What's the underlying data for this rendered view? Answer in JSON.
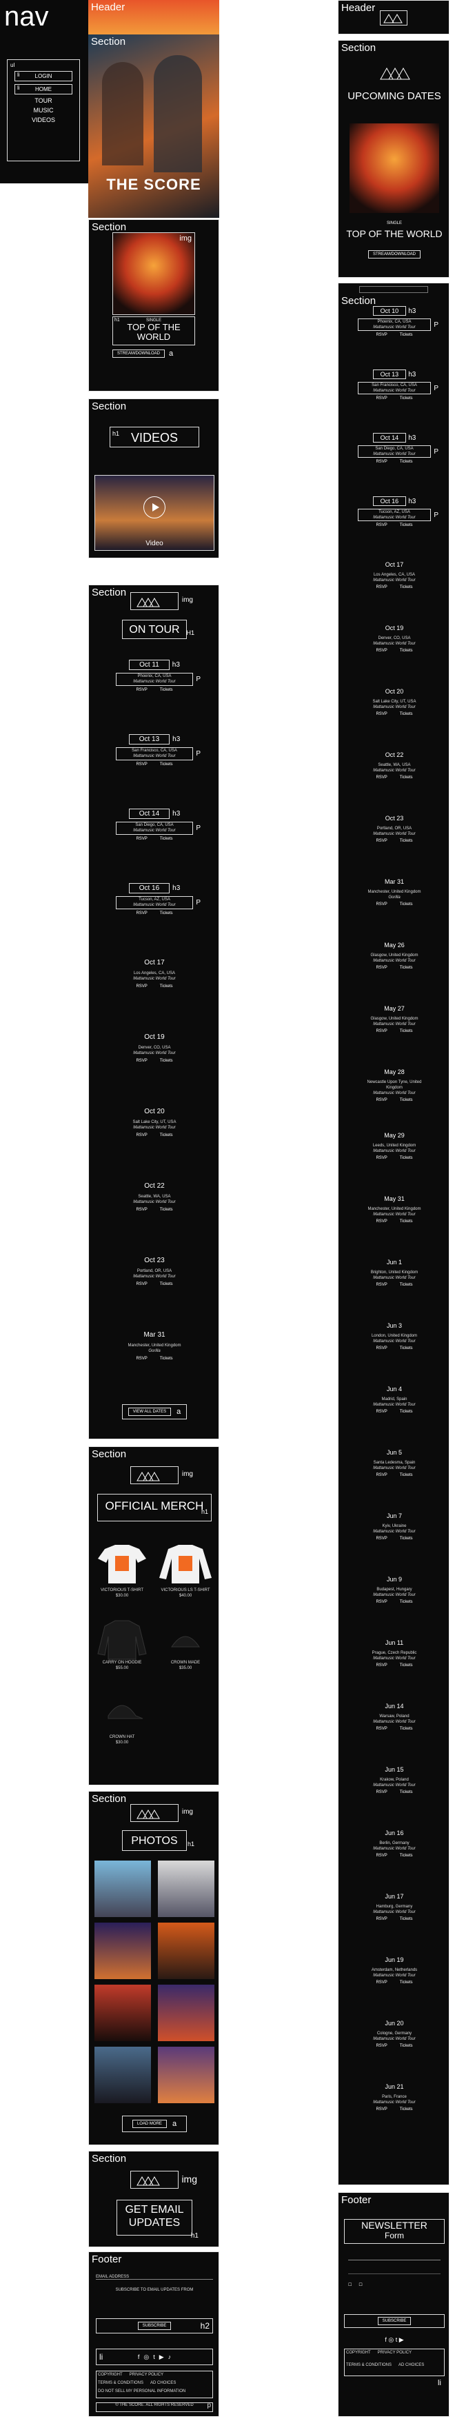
{
  "nav": {
    "title": "nav",
    "items": [
      {
        "tag": "li",
        "label": "LOGIN",
        "mark": "li"
      },
      {
        "tag": "li",
        "label": "HOME",
        "mark": "li"
      },
      {
        "label": "TOUR"
      },
      {
        "label": "MUSIC"
      },
      {
        "label": "VIDEOS"
      }
    ]
  },
  "mobile": {
    "header_tag": "Header",
    "section_tag": "Section",
    "hero_logo": "THE SCORE",
    "album": {
      "img_tag": "img",
      "h1_tag": "h1",
      "single": "SINGLE",
      "title": "TOP OF THE WORLD",
      "button": "STREAM/DOWNLOAD",
      "a_tag": "a"
    },
    "videos": {
      "h1_tag": "h1",
      "title": "VIDEOS",
      "caption": "Video"
    },
    "tour": {
      "img_tag": "img",
      "title": "ON TOUR",
      "h1_tag": "H1",
      "h3_tag": "h3",
      "p_tag": "P",
      "view_all": "VIEW ALL DATES",
      "a_tag": "a",
      "dates": [
        {
          "date": "Oct 11",
          "city": "Phoenix, CA, USA",
          "venue": "Mattamusic World Tour",
          "rsvp": "RSVP",
          "tickets": "Tickets"
        },
        {
          "date": "Oct 13",
          "city": "San Francisco, CA, USA",
          "venue": "Mattamusic World Tour",
          "rsvp": "RSVP",
          "tickets": "Tickets"
        },
        {
          "date": "Oct 14",
          "city": "San Diego, CA, USA",
          "venue": "Mattamusic World Tour",
          "rsvp": "RSVP",
          "tickets": "Tickets"
        },
        {
          "date": "Oct 16",
          "city": "Tucson, AZ, USA",
          "venue": "Mattamusic World Tour",
          "rsvp": "RSVP",
          "tickets": "Tickets"
        },
        {
          "date": "Oct 17",
          "city": "Los Angeles, CA, USA",
          "venue": "Mattamusic World Tour",
          "rsvp": "RSVP",
          "tickets": "Tickets"
        },
        {
          "date": "Oct 19",
          "city": "Denver, CO, USA",
          "venue": "Mattamusic World Tour",
          "rsvp": "RSVP",
          "tickets": "Tickets"
        },
        {
          "date": "Oct 20",
          "city": "Salt Lake City, UT, USA",
          "venue": "Mattamusic World Tour",
          "rsvp": "RSVP",
          "tickets": "Tickets"
        },
        {
          "date": "Oct 22",
          "city": "Seattle, WA, USA",
          "venue": "Mattamusic World Tour",
          "rsvp": "RSVP",
          "tickets": "Tickets"
        },
        {
          "date": "Oct 23",
          "city": "Portland, OR, USA",
          "venue": "Mattamusic World Tour",
          "rsvp": "RSVP",
          "tickets": "Tickets"
        },
        {
          "date": "Mar 31",
          "city": "Manchester, United Kingdom",
          "venue": "Gorilla",
          "rsvp": "RSVP",
          "tickets": "Tickets"
        }
      ]
    },
    "merch": {
      "img_tag": "img",
      "title": "OFFICIAL MERCH",
      "h1_tag": "h1",
      "items": [
        {
          "name": "VICTORIOUS T-SHIRT",
          "price": "$30.00"
        },
        {
          "name": "VICTORIOUS LS T-SHIRT",
          "price": "$40.00"
        },
        {
          "name": "CARRY ON HOODIE",
          "price": "$55.00"
        },
        {
          "name": "CROWN MADE",
          "price": "$35.00"
        },
        {
          "name": "CROWN HAT",
          "price": "$30.00"
        }
      ]
    },
    "photos": {
      "img_tag": "img",
      "title": "PHOTOS",
      "h1_tag": "h1",
      "more": "LOAD MORE",
      "a_tag": "a"
    },
    "email": {
      "img_tag": "img",
      "title": "GET EMAIL UPDATES",
      "h1_tag": "h1"
    },
    "footer": {
      "tag": "Footer",
      "email_placeholder": "EMAIL ADDRESS",
      "subscribe_label": "SUBSCRIBE TO EMAIL UPDATES FROM",
      "subscribe_button": "SUBSCRIBE",
      "h2_tag": "h2",
      "li_tag": "li",
      "p_tag": "p",
      "links": [
        "COPYRIGHT",
        "PRIVACY POLICY",
        "TERMS & CONDITIONS",
        "AD CHOICES",
        "DO NOT SELL MY PERSONAL INFORMATION"
      ],
      "legal": "© THE SCORE. ALL RIGHTS RESERVED"
    }
  },
  "desktop": {
    "header_tag": "Header",
    "section_tag": "Section",
    "upcoming_title": "UPCOMING DATES",
    "single": "SINGLE",
    "album_title": "TOP OF THE WORLD",
    "button": "STREAM/DOWNLOAD",
    "h3_tag": "h3",
    "p_tag": "P",
    "dates": [
      {
        "date": "Oct 10",
        "city": "Phoenix, CA, USA",
        "venue": "Mattamusic World Tour"
      },
      {
        "date": "Oct 13",
        "city": "San Francisco, CA, USA",
        "venue": "Mattamusic World Tour"
      },
      {
        "date": "Oct 14",
        "city": "San Diego, CA, USA",
        "venue": "Mattamusic World Tour"
      },
      {
        "date": "Oct 16",
        "city": "Tucson, AZ, USA",
        "venue": "Mattamusic World Tour"
      },
      {
        "date": "Oct 17",
        "city": "Los Angeles, CA, USA",
        "venue": "Mattamusic World Tour"
      },
      {
        "date": "Oct 19",
        "city": "Denver, CO, USA",
        "venue": "Mattamusic World Tour"
      },
      {
        "date": "Oct 20",
        "city": "Salt Lake City, UT, USA",
        "venue": "Mattamusic World Tour"
      },
      {
        "date": "Oct 22",
        "city": "Seattle, WA, USA",
        "venue": "Mattamusic World Tour"
      },
      {
        "date": "Oct 23",
        "city": "Portland, OR, USA",
        "venue": "Mattamusic World Tour"
      },
      {
        "date": "Mar 31",
        "city": "Manchester, United Kingdom",
        "venue": "Gorilla"
      },
      {
        "date": "May 26",
        "city": "Glasgow, United Kingdom",
        "venue": "Mattamusic World Tour"
      },
      {
        "date": "May 27",
        "city": "Glasgow, United Kingdom",
        "venue": "Mattamusic World Tour"
      },
      {
        "date": "May 28",
        "city": "Newcastle Upon Tyne, United Kingdom",
        "venue": "Mattamusic World Tour"
      },
      {
        "date": "May 29",
        "city": "Leeds, United Kingdom",
        "venue": "Mattamusic World Tour"
      },
      {
        "date": "May 31",
        "city": "Manchester, United Kingdom",
        "venue": "Mattamusic World Tour"
      },
      {
        "date": "Jun 1",
        "city": "Brighton, United Kingdom",
        "venue": "Mattamusic World Tour"
      },
      {
        "date": "Jun 3",
        "city": "London, United Kingdom",
        "venue": "Mattamusic World Tour"
      },
      {
        "date": "Jun 4",
        "city": "Madrid, Spain",
        "venue": "Mattamusic World Tour"
      },
      {
        "date": "Jun 5",
        "city": "Santa Ledesma, Spain",
        "venue": "Mattamusic World Tour"
      },
      {
        "date": "Jun 7",
        "city": "Kyiv, Ukraine",
        "venue": "Mattamusic World Tour"
      },
      {
        "date": "Jun 9",
        "city": "Budapest, Hungary",
        "venue": "Mattamusic World Tour"
      },
      {
        "date": "Jun 11",
        "city": "Prague, Czech Republic",
        "venue": "Mattamusic World Tour"
      },
      {
        "date": "Jun 14",
        "city": "Warsaw, Poland",
        "venue": "Mattamusic World Tour"
      },
      {
        "date": "Jun 15",
        "city": "Krakow, Poland",
        "venue": "Mattamusic World Tour"
      },
      {
        "date": "Jun 16",
        "city": "Berlin, Germany",
        "venue": "Mattamusic World Tour"
      },
      {
        "date": "Jun 17",
        "city": "Hamburg, Germany",
        "venue": "Mattamusic World Tour"
      },
      {
        "date": "Jun 19",
        "city": "Amsterdam, Netherlands",
        "venue": "Mattamusic World Tour"
      },
      {
        "date": "Jun 20",
        "city": "Cologne, Germany",
        "venue": "Mattamusic World Tour"
      },
      {
        "date": "Jun 21",
        "city": "Paris, France",
        "venue": "Mattamusic World Tour"
      }
    ],
    "rsvp": "RSVP",
    "tickets": "Tickets",
    "footer": {
      "tag": "Footer",
      "newsletter": "NEWSLETTER",
      "form_tag": "Form",
      "subscribe_button": "SUBSCRIBE",
      "li_tag": "li",
      "links": [
        "COPYRIGHT",
        "PRIVACY POLICY",
        "TERMS & CONDITIONS",
        "AD CHOICES"
      ]
    }
  },
  "colors": {
    "bg": "#0b0b0b",
    "accent": "#f26a21",
    "line": "#e8e8e8"
  }
}
